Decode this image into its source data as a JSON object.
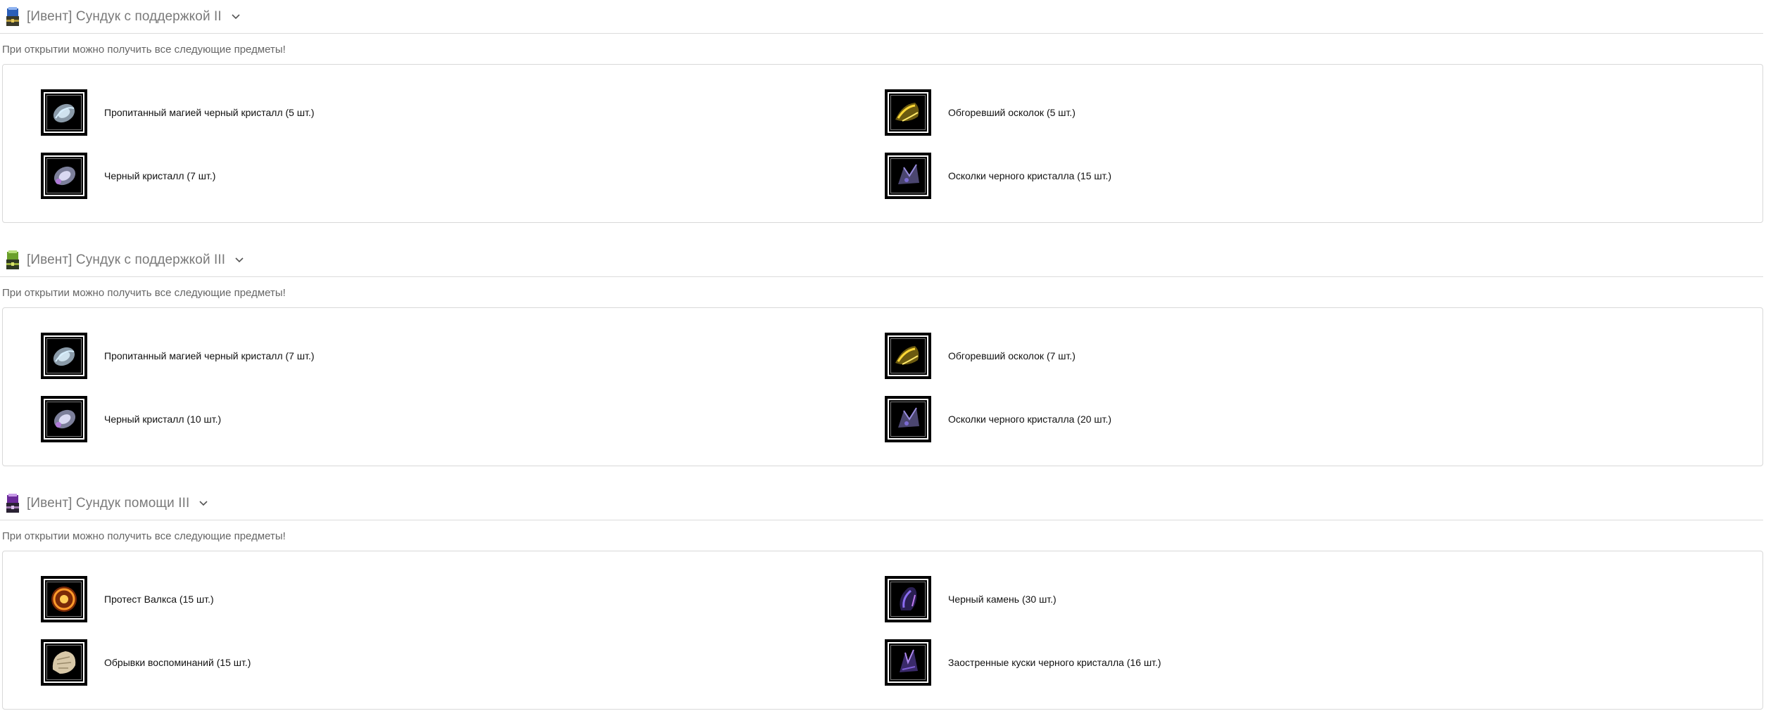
{
  "subtitle_text": "При открытии можно получить все следующие предметы!",
  "sections": [
    {
      "title": "[Ивент] Сундук с поддержкой II",
      "chest_icon": "chest-blue-icon",
      "items": [
        {
          "label": "Пропитанный магией черный кристалл (5 шт.)",
          "icon": "magic-black-crystal-icon"
        },
        {
          "label": "Обгоревший осколок (5 шт.)",
          "icon": "burnt-shard-icon"
        },
        {
          "label": "Черный кристалл (7 шт.)",
          "icon": "black-crystal-icon"
        },
        {
          "label": "Осколки черного кристалла (15 шт.)",
          "icon": "black-crystal-shards-icon"
        }
      ]
    },
    {
      "title": "[Ивент] Сундук с поддержкой III",
      "chest_icon": "chest-green-icon",
      "items": [
        {
          "label": "Пропитанный магией черный кристалл (7 шт.)",
          "icon": "magic-black-crystal-icon"
        },
        {
          "label": "Обгоревший осколок (7 шт.)",
          "icon": "burnt-shard-icon"
        },
        {
          "label": "Черный кристалл (10 шт.)",
          "icon": "black-crystal-icon"
        },
        {
          "label": "Осколки черного кристалла (20 шт.)",
          "icon": "black-crystal-shards-icon"
        }
      ]
    },
    {
      "title": "[Ивент] Сундук помощи III",
      "chest_icon": "chest-purple-icon",
      "items": [
        {
          "label": "Протест Валкса (15 шт.)",
          "icon": "valks-protest-icon"
        },
        {
          "label": "Черный камень (30 шт.)",
          "icon": "black-stone-icon"
        },
        {
          "label": "Обрывки воспоминаний (15 шт.)",
          "icon": "memory-fragments-icon"
        },
        {
          "label": "Заостренные куски черного кристалла (16 шт.)",
          "icon": "sharp-black-crystal-icon"
        }
      ]
    }
  ],
  "colors": {
    "title": "#7a7a7a",
    "subtitle": "#666666",
    "border": "#d8d8d8",
    "icon_bg": "#000000"
  }
}
